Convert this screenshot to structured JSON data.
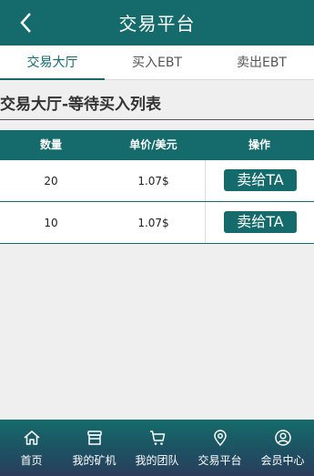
{
  "header": {
    "title": "交易平台",
    "back_icon": "chevron-left-icon"
  },
  "tabs": [
    {
      "label": "交易大厅",
      "active": true
    },
    {
      "label": "买入EBT",
      "active": false
    },
    {
      "label": "卖出EBT",
      "active": false
    }
  ],
  "section": {
    "title": "交易大厅-等待买入列表"
  },
  "table": {
    "headers": [
      "数量",
      "单价/美元",
      "操作"
    ],
    "rows": [
      {
        "quantity": "20",
        "price": "1.07$",
        "action": "卖给TA"
      },
      {
        "quantity": "10",
        "price": "1.07$",
        "action": "卖给TA"
      }
    ]
  },
  "bottom_nav": {
    "items": [
      {
        "label": "首页",
        "icon": "home-icon"
      },
      {
        "label": "我的矿机",
        "icon": "store-icon"
      },
      {
        "label": "我的团队",
        "icon": "cart-icon"
      },
      {
        "label": "交易平台",
        "icon": "location-pin-icon"
      },
      {
        "label": "会员中心",
        "icon": "user-circle-icon"
      }
    ]
  },
  "colors": {
    "primary": "#156b6b",
    "background": "#efefef"
  }
}
